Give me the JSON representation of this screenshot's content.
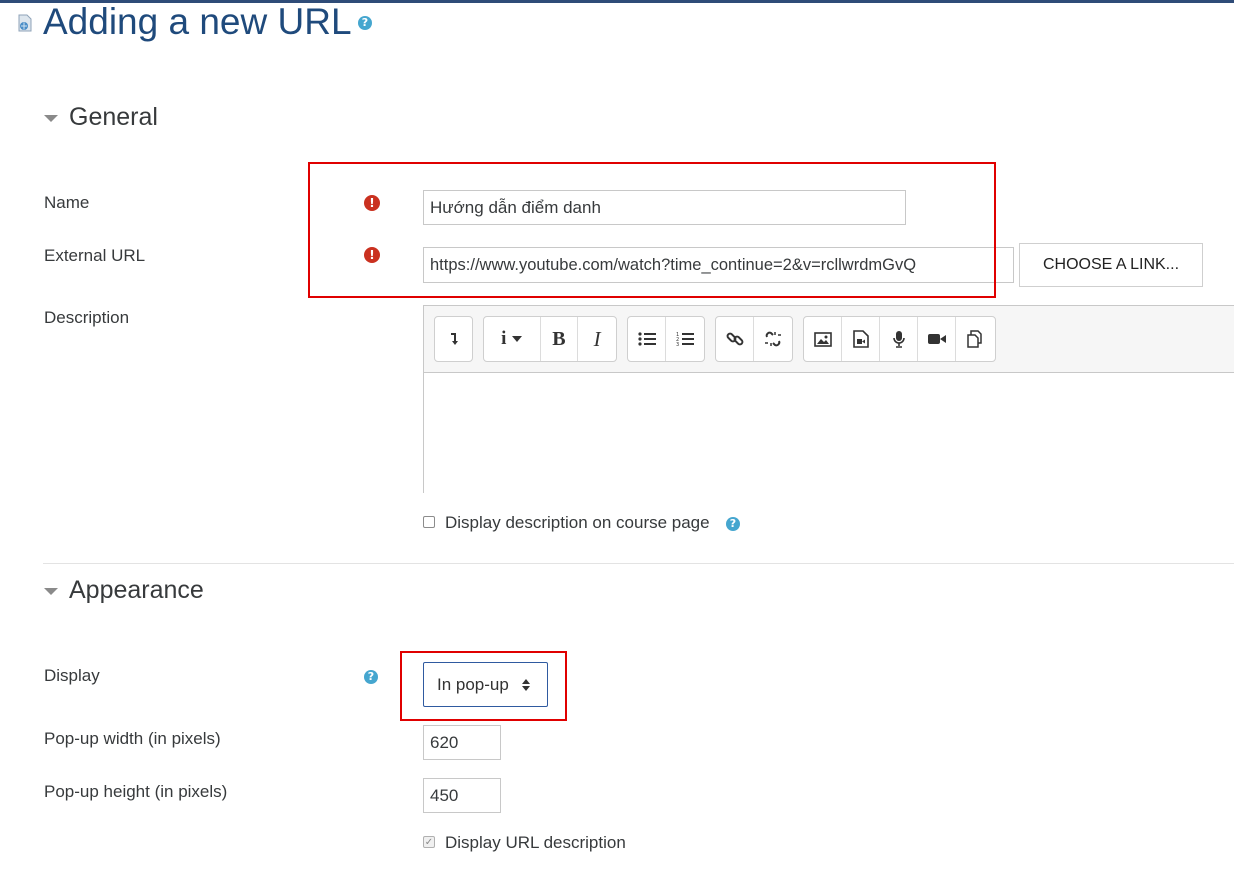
{
  "page": {
    "title": "Adding a new URL"
  },
  "sections": {
    "general": "General",
    "appearance": "Appearance"
  },
  "fields": {
    "name": {
      "label": "Name",
      "value": "Hướng dẫn điểm danh"
    },
    "external_url": {
      "label": "External URL",
      "value": "https://www.youtube.com/watch?time_continue=2&v=rcllwrdmGvQ",
      "button": "CHOOSE A LINK..."
    },
    "description": {
      "label": "Description"
    },
    "display_description": {
      "label": "Display description on course page",
      "checked": false
    },
    "display": {
      "label": "Display",
      "value": "In pop-up"
    },
    "popup_width": {
      "label": "Pop-up width (in pixels)",
      "value": "620"
    },
    "popup_height": {
      "label": "Pop-up height (in pixels)",
      "value": "450"
    },
    "display_url_description": {
      "label": "Display URL description",
      "checked": true
    }
  },
  "editor_toolbar": {
    "groups": [
      [
        "collapse-icon"
      ],
      [
        "info-dropdown-icon",
        "bold-icon",
        "italic-icon"
      ],
      [
        "unordered-list-icon",
        "ordered-list-icon"
      ],
      [
        "link-icon",
        "unlink-icon"
      ],
      [
        "image-icon",
        "media-icon",
        "record-audio-icon",
        "record-video-icon",
        "manage-files-icon"
      ]
    ]
  },
  "colors": {
    "title": "#1f4a7c",
    "required": "#ca3120",
    "help": "#45a6cf",
    "highlight_box": "#e00000"
  }
}
